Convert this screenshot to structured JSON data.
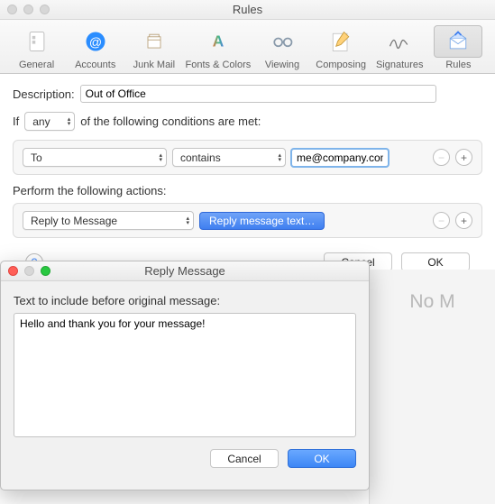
{
  "mainWindow": {
    "title": "Rules",
    "toolbar": [
      {
        "label": "General",
        "icon": "general"
      },
      {
        "label": "Accounts",
        "icon": "accounts"
      },
      {
        "label": "Junk Mail",
        "icon": "junk"
      },
      {
        "label": "Fonts & Colors",
        "icon": "fonts"
      },
      {
        "label": "Viewing",
        "icon": "viewing"
      },
      {
        "label": "Composing",
        "icon": "composing"
      },
      {
        "label": "Signatures",
        "icon": "signatures"
      },
      {
        "label": "Rules",
        "icon": "rules",
        "selected": true
      }
    ],
    "descriptionLabel": "Description:",
    "descriptionValue": "Out of Office",
    "ifLabel": "If",
    "anySelect": "any",
    "conditionsTail": "of the following conditions are met:",
    "condition": {
      "field": "To",
      "operator": "contains",
      "value": "me@company.com"
    },
    "actionsLabel": "Perform the following actions:",
    "action": {
      "type": "Reply to Message",
      "buttonLabel": "Reply message text…"
    },
    "cancelLabel": "Cancel",
    "okLabel": "OK"
  },
  "bgText": "No M",
  "dialog": {
    "title": "Reply Message",
    "prompt": "Text to include before original message:",
    "bodyText": "Hello and thank you for your message!",
    "cancelLabel": "Cancel",
    "okLabel": "OK"
  }
}
